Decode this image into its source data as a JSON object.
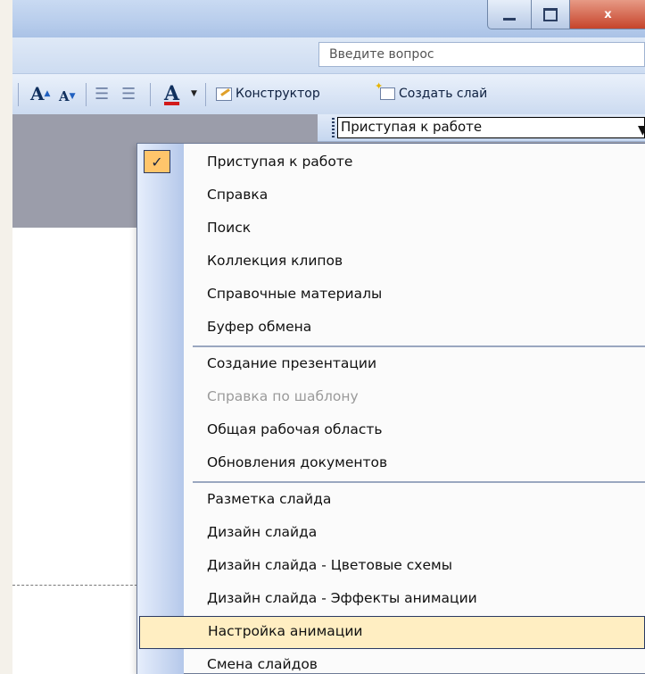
{
  "window": {
    "close_glyph": "x"
  },
  "help": {
    "question_placeholder": "Введите вопрос"
  },
  "toolbar": {
    "increase_font_label": "A",
    "decrease_font_label": "A",
    "font_color_label": "A",
    "design_label": "Конструктор",
    "new_slide_label": "Создать слай"
  },
  "task_pane": {
    "selected": "Приступая к работе"
  },
  "menu": {
    "items": [
      {
        "label": "Приступая к работе",
        "checked": true
      },
      {
        "label": "Справка"
      },
      {
        "label": "Поиск"
      },
      {
        "label": "Коллекция клипов"
      },
      {
        "label": "Справочные материалы"
      },
      {
        "label": "Буфер обмена"
      },
      {
        "label": "Создание презентации"
      },
      {
        "label": "Справка по шаблону",
        "disabled": true
      },
      {
        "label": "Общая рабочая область"
      },
      {
        "label": "Обновления документов"
      },
      {
        "label": "Разметка слайда"
      },
      {
        "label": "Дизайн слайда"
      },
      {
        "label": "Дизайн слайда - Цветовые схемы"
      },
      {
        "label": "Дизайн слайда - Эффекты анимации"
      },
      {
        "label": "Настройка анимации",
        "highlighted": true
      },
      {
        "label": "Смена слайдов"
      }
    ]
  },
  "colors": {
    "highlight": "#ffeec2",
    "check_bg": "#ffc56b",
    "gutter": "#b5c8ea",
    "workspace_gray": "#9b9daa"
  }
}
